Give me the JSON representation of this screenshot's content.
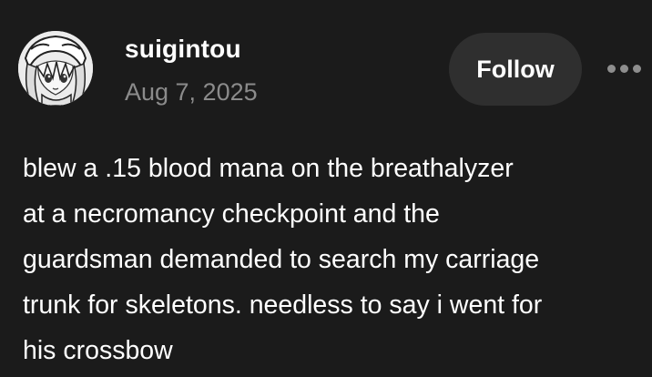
{
  "author": {
    "username": "suigintou",
    "date": "Aug 7, 2025",
    "avatar_icon": "anime-girl-avatar"
  },
  "actions": {
    "follow_label": "Follow",
    "more_icon": "more-horizontal-icon"
  },
  "post": {
    "lines": [
      "blew a .15 blood mana on the breathalyzer",
      "at a necromancy checkpoint and the",
      "guardsman demanded to search my carriage",
      "trunk for skeletons. needless to say i went for",
      "his crossbow"
    ]
  },
  "colors": {
    "background": "#1b1b1b",
    "text": "#ffffff",
    "muted_text": "#8b8b8b",
    "button_bg": "#2f2f2f"
  }
}
